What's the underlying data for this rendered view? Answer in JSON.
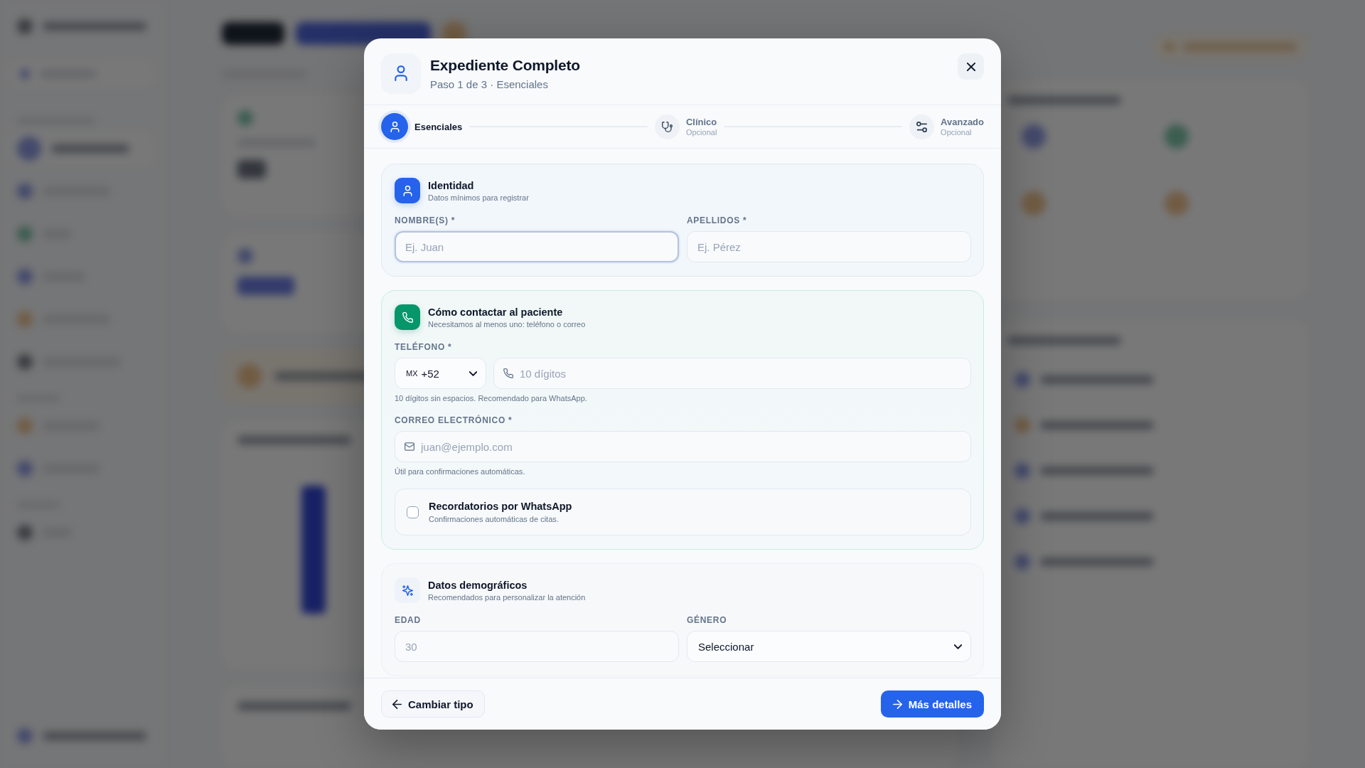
{
  "dialog": {
    "title": "Expediente Completo",
    "subtitle": "Paso 1 de 3 · Esenciales"
  },
  "steps": [
    {
      "kind": "basic",
      "label": "Esenciales",
      "selected": true
    },
    {
      "kind": "clinical",
      "label": "Clínico",
      "hint": "Opcional",
      "selected": false
    },
    {
      "kind": "advanced",
      "label": "Avanzado",
      "hint": "Opcional",
      "selected": false
    }
  ],
  "sections": [
    {
      "kind": "identity",
      "title": "Identidad",
      "subtitle": "Datos mínimos para registrar",
      "fields": [
        {
          "kind": "text",
          "label": "NOMBRE(S) *",
          "placeholder": "Ej. Juan",
          "focused": true
        },
        {
          "kind": "text",
          "label": "APELLIDOS *",
          "placeholder": "Ej. Pérez",
          "focused": false
        }
      ]
    },
    {
      "kind": "contact",
      "title": "Cómo contactar al paciente",
      "subtitle": "Necesitamos al menos uno: teléfono o correo",
      "fields": [
        {
          "kind": "phone",
          "label": "TELÉFONO *",
          "country": "MX",
          "dial_code": "+52",
          "placeholder": "10 dígitos",
          "hint": "10 dígitos sin espacios. Recomendado para WhatsApp.",
          "focused": false
        },
        {
          "kind": "email",
          "label": "CORREO ELECTRÓNICO *",
          "placeholder": "juan@ejemplo.com",
          "hint": "Útil para confirmaciones automáticas.",
          "focused": false
        },
        {
          "kind": "checkbox",
          "title": "Recordatorios por WhatsApp",
          "description": "Confirmaciones automáticas de citas.",
          "checked": false
        }
      ]
    },
    {
      "kind": "demographics",
      "title": "Datos demográficos",
      "subtitle": "Recomendados para personalizar la atención",
      "fields": [
        {
          "kind": "text",
          "label": "EDAD",
          "placeholder": "30",
          "focused": false
        },
        {
          "kind": "select",
          "label": "GÉNERO",
          "value": "Seleccionar",
          "focused": false
        }
      ]
    }
  ],
  "footer": {
    "buttons": [
      {
        "kind": "back",
        "label": "Cambiar tipo"
      },
      {
        "kind": "next",
        "label": "Más detalles"
      }
    ]
  }
}
